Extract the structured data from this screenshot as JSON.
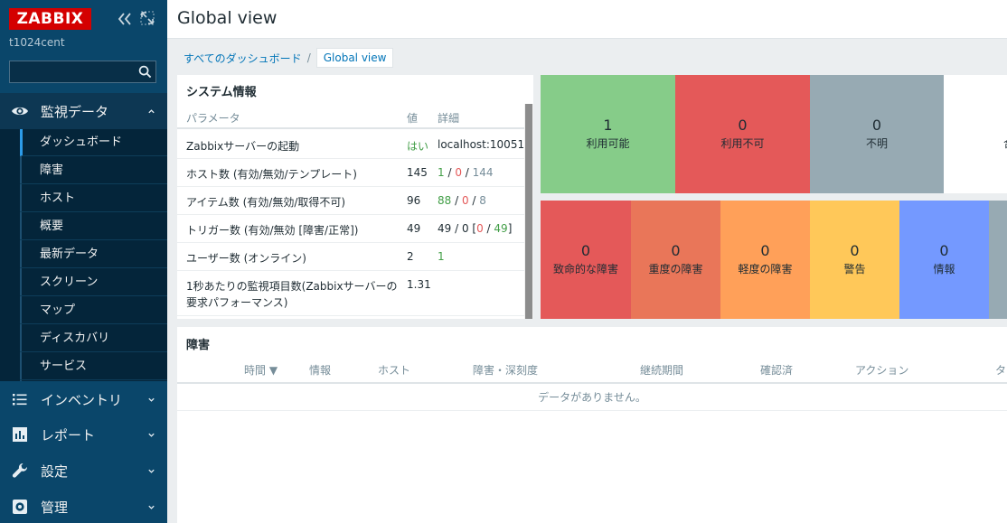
{
  "sidebar": {
    "logo_text": "ZABBIX",
    "server_name": "t1024cent",
    "search_placeholder": "",
    "sections": [
      {
        "label": "監視データ",
        "icon": "eye-icon",
        "expanded": true
      },
      {
        "label": "インベントリ",
        "icon": "list-icon"
      },
      {
        "label": "レポート",
        "icon": "bar-chart-icon"
      },
      {
        "label": "設定",
        "icon": "wrench-icon"
      },
      {
        "label": "管理",
        "icon": "gear-icon"
      }
    ],
    "monitoring_items": [
      {
        "label": "ダッシュボード",
        "active": true
      },
      {
        "label": "障害"
      },
      {
        "label": "ホスト"
      },
      {
        "label": "概要"
      },
      {
        "label": "最新データ"
      },
      {
        "label": "スクリーン"
      },
      {
        "label": "マップ"
      },
      {
        "label": "ディスカバリ"
      },
      {
        "label": "サービス"
      }
    ]
  },
  "header": {
    "title": "Global view"
  },
  "breadcrumb": {
    "parent": "すべてのダッシュボード",
    "separator": "/",
    "current": "Global view"
  },
  "system_info": {
    "title": "システム情報",
    "columns": [
      "パラメータ",
      "値",
      "詳細"
    ],
    "rows": [
      {
        "param": "Zabbixサーバーの起動",
        "value": "はい",
        "detail": "localhost:10051"
      },
      {
        "param": "ホスト数 (有効/無効/テンプレート)",
        "value": "145",
        "detail_parts": [
          "1",
          "0",
          "144"
        ]
      },
      {
        "param": "アイテム数 (有効/無効/取得不可)",
        "value": "96",
        "detail_parts": [
          "88",
          "0",
          "8"
        ]
      },
      {
        "param": "トリガー数 (有効/無効 [障害/正常])",
        "value": "49",
        "detail_parts": [
          "49",
          "0",
          "0",
          "49"
        ]
      },
      {
        "param": "ユーザー数 (オンライン)",
        "value": "2",
        "detail": "1"
      },
      {
        "param_line1": "1秒あたりの監視項目数(Zabbixサーバーの",
        "param_line2": "要求パフォーマンス)",
        "value": "1.31"
      }
    ]
  },
  "host_availability": [
    {
      "count": "1",
      "label": "利用可能",
      "color": "#86cc89"
    },
    {
      "count": "0",
      "label": "利用不可",
      "color": "#e45959"
    },
    {
      "count": "0",
      "label": "不明",
      "color": "#97aab3"
    },
    {
      "count": "",
      "label": "合",
      "color": "#ffffff"
    }
  ],
  "severity": [
    {
      "count": "0",
      "label": "致命的な障害",
      "color": "#e45959"
    },
    {
      "count": "0",
      "label": "重度の障害",
      "color": "#e97659"
    },
    {
      "count": "0",
      "label": "軽度の障害",
      "color": "#ffa059"
    },
    {
      "count": "0",
      "label": "警告",
      "color": "#ffc859"
    },
    {
      "count": "0",
      "label": "情報",
      "color": "#7499ff"
    },
    {
      "count": "",
      "label": "",
      "color": "#97aab3"
    }
  ],
  "problems": {
    "title": "障害",
    "columns": [
      "時間",
      "情報",
      "ホスト",
      "障害・深刻度",
      "継続期間",
      "確認済",
      "アクション",
      "タ"
    ],
    "sort_indicator": "▼",
    "empty_text": "データがありません。"
  }
}
